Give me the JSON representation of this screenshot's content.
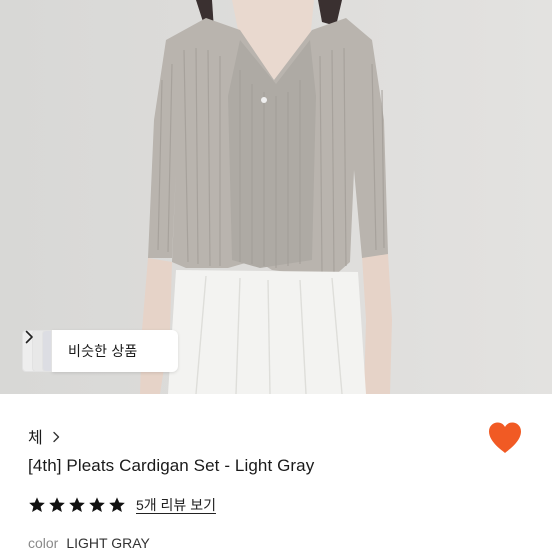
{
  "product": {
    "photo_alt": "",
    "similar_button_label": "비슷한 상품",
    "shop_name": "체",
    "title": "[4th] Pleats Cardigan Set - Light Gray",
    "rating_stars": 5,
    "review_link": "5개 리뷰 보기",
    "color_label": "color",
    "color_value": "LIGHT GRAY"
  },
  "colors": {
    "heart": "#F15A24",
    "star": "#111111",
    "text_primary": "#1a1a1a",
    "text_muted": "#8a8a8a"
  },
  "icons": {
    "similar": "chevron-right-icon",
    "shop": "chevron-right-icon",
    "wishlist": "heart-icon",
    "rating": "star-icon"
  }
}
